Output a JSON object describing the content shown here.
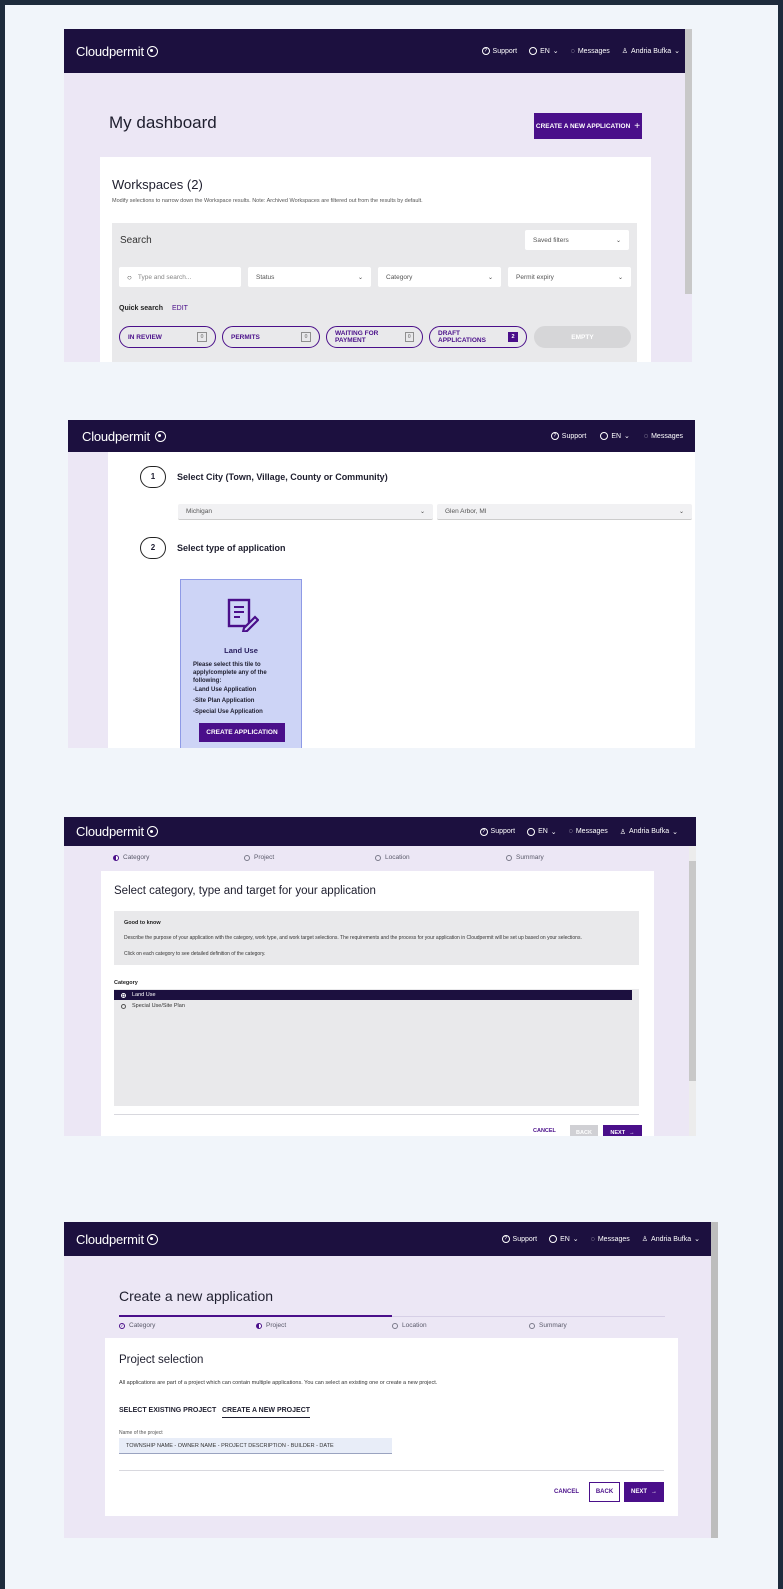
{
  "brand": "Cloudpermit",
  "nav": {
    "support": "Support",
    "lang": "EN",
    "messages": "Messages",
    "user": "Andria Bufka"
  },
  "dashboard": {
    "title": "My dashboard",
    "create_button": "CREATE A NEW APPLICATION",
    "workspaces_title": "Workspaces (2)",
    "workspaces_desc": "Modify selections to narrow down the Workspace results. Note: Archived Workspaces are filtered out from the results by default.",
    "search_title": "Search",
    "saved_filters": "Saved filters",
    "search_placeholder": "Type and search...",
    "status": "Status",
    "category": "Category",
    "permit_expiry": "Permit expiry",
    "quick_search": "Quick search",
    "edit": "EDIT",
    "pills": [
      {
        "label": "IN REVIEW",
        "count": "0"
      },
      {
        "label": "PERMITS",
        "count": "0"
      },
      {
        "label": "WAITING FOR PAYMENT",
        "count": "0"
      },
      {
        "label": "DRAFT APPLICATIONS",
        "count": "2"
      }
    ],
    "empty": "EMPTY"
  },
  "select_city": {
    "step1_num": "1",
    "step1_title": "Select City (Town, Village, County or Community)",
    "state": "Michigan",
    "city": "Glen Arbor, MI",
    "step2_num": "2",
    "step2_title": "Select type of application",
    "tile_title": "Land Use",
    "tile_desc": "Please select this tile to apply/complete any of the following:",
    "tile_items": [
      "-Land Use Application",
      "-Site Plan Application",
      "-Special Use Application"
    ],
    "tile_button": "CREATE APPLICATION"
  },
  "category_page": {
    "steps": [
      "Category",
      "Project",
      "Location",
      "Summary"
    ],
    "title": "Select category, type and target for your application",
    "good_to_know": "Good to know",
    "info_line1": "Describe the purpose of your application with the category, work type, and work target selections. The requirements and the process for your application in Cloudpermit will be set up based on your selections.",
    "info_line2": "Click on each category to see detailed definition of the category.",
    "category_label": "Category",
    "options": [
      "Land Use",
      "Special Use/Site Plan"
    ],
    "cancel": "CANCEL",
    "back": "BACK",
    "next": "NEXT"
  },
  "project_page": {
    "title": "Create a new application",
    "steps": [
      "Category",
      "Project",
      "Location",
      "Summary"
    ],
    "section_title": "Project selection",
    "desc": "All applications are part of a project which can contain multiple applications. You can select an existing one or create a new project.",
    "tab_existing": "SELECT EXISTING PROJECT",
    "tab_new": "CREATE A NEW PROJECT",
    "field_label": "Name of the project",
    "field_value": "TOWNSHIP NAME - OWNER NAME - PROJECT DESCRIPTION - BUILDER - DATE",
    "cancel": "CANCEL",
    "back": "BACK",
    "next": "NEXT"
  },
  "colors": {
    "header": "#1c103f",
    "accent": "#4a0f8a",
    "lavender": "#ece7f5"
  }
}
